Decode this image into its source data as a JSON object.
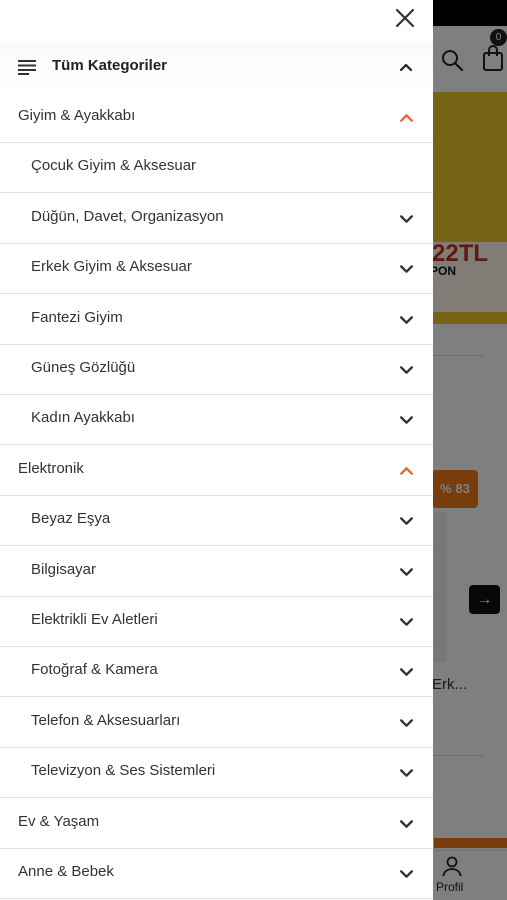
{
  "background": {
    "cart_count": "0",
    "banner_price": "22TL",
    "banner_coupon": "PON",
    "discount_badge": "% 83",
    "product_name": "Erk...",
    "bottom_nav_profile": "Profil"
  },
  "drawer": {
    "all_categories_label": "Tüm Kategoriler",
    "rows": [
      {
        "label": "Giyim & Ayakkabı",
        "type": "category",
        "expanded": true
      },
      {
        "label": "Çocuk Giyim & Aksesuar",
        "type": "sub",
        "has_chevron": false
      },
      {
        "label": "Düğün, Davet, Organizasyon",
        "type": "sub",
        "has_chevron": true
      },
      {
        "label": "Erkek Giyim & Aksesuar",
        "type": "sub",
        "has_chevron": true
      },
      {
        "label": "Fantezi Giyim",
        "type": "sub",
        "has_chevron": true
      },
      {
        "label": "Güneş Gözlüğü",
        "type": "sub",
        "has_chevron": true
      },
      {
        "label": "Kadın Ayakkabı",
        "type": "sub",
        "has_chevron": true
      },
      {
        "label": "Elektronik",
        "type": "category",
        "expanded": true
      },
      {
        "label": "Beyaz Eşya",
        "type": "sub",
        "has_chevron": true
      },
      {
        "label": "Bilgisayar",
        "type": "sub",
        "has_chevron": true
      },
      {
        "label": "Elektrikli Ev Aletleri",
        "type": "sub",
        "has_chevron": true
      },
      {
        "label": "Fotoğraf & Kamera",
        "type": "sub",
        "has_chevron": true
      },
      {
        "label": "Telefon & Aksesuarları",
        "type": "sub",
        "has_chevron": true
      },
      {
        "label": "Televizyon & Ses Sistemleri",
        "type": "sub",
        "has_chevron": true
      },
      {
        "label": "Ev & Yaşam",
        "type": "category",
        "expanded": false
      },
      {
        "label": "Anne & Bebek",
        "type": "category",
        "expanded": false
      }
    ]
  },
  "colors": {
    "accent": "#e8643c",
    "text": "#333333",
    "divider": "#e2e2e2"
  },
  "icons": {
    "close": "close-icon",
    "menu": "menu-lines-icon",
    "chevron_up": "chevron-up-icon",
    "chevron_down": "chevron-down-icon"
  }
}
